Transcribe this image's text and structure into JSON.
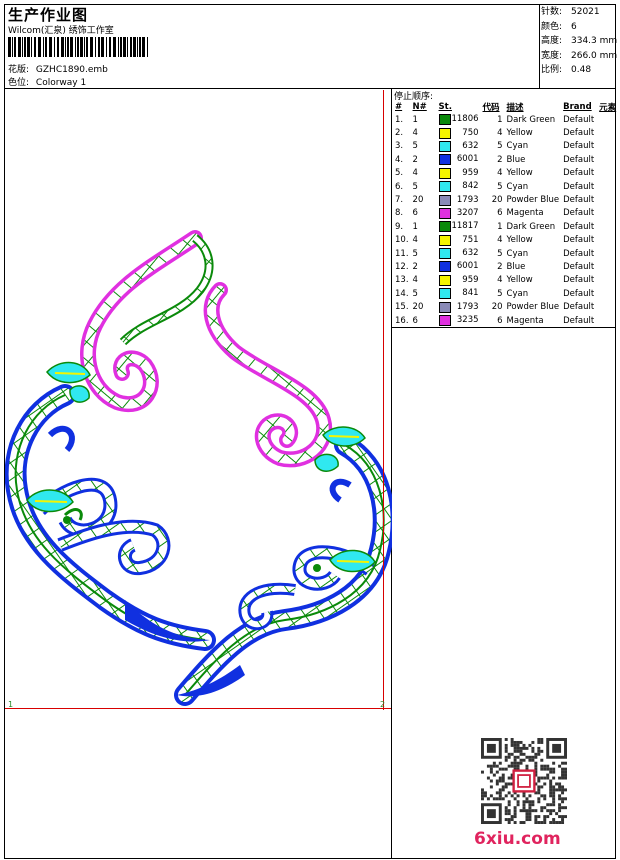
{
  "header": {
    "title": "生产作业图",
    "subtitle": "Wilcom(汇泉) 绣饰工作室",
    "design_label": "花版:",
    "design_value": "GZHC1890.emb",
    "colorway_label": "色位:",
    "colorway_value": "Colorway 1"
  },
  "stats": [
    {
      "label": "针数:",
      "value": "52021"
    },
    {
      "label": "颜色:",
      "value": "6"
    },
    {
      "label": "高度:",
      "value": "334.3 mm"
    },
    {
      "label": "宽度:",
      "value": "266.0 mm"
    },
    {
      "label": "比例:",
      "value": "0.48"
    }
  ],
  "sequence": {
    "title": "停止顺序:",
    "headers": [
      "#",
      "N#",
      "St.",
      "代码",
      "描述",
      "Brand",
      "元素"
    ],
    "rows": [
      {
        "idx": "1.",
        "n": "1",
        "color": "#0a8a0a",
        "st": "11806",
        "code": "1",
        "desc": "Dark Green",
        "brand": "Default"
      },
      {
        "idx": "2.",
        "n": "4",
        "color": "#f5f500",
        "st": "750",
        "code": "4",
        "desc": "Yellow",
        "brand": "Default"
      },
      {
        "idx": "3.",
        "n": "5",
        "color": "#30e8f0",
        "st": "632",
        "code": "5",
        "desc": "Cyan",
        "brand": "Default"
      },
      {
        "idx": "4.",
        "n": "2",
        "color": "#1030e0",
        "st": "6001",
        "code": "2",
        "desc": "Blue",
        "brand": "Default"
      },
      {
        "idx": "5.",
        "n": "4",
        "color": "#f5f500",
        "st": "959",
        "code": "4",
        "desc": "Yellow",
        "brand": "Default"
      },
      {
        "idx": "6.",
        "n": "5",
        "color": "#30e8f0",
        "st": "842",
        "code": "5",
        "desc": "Cyan",
        "brand": "Default"
      },
      {
        "idx": "7.",
        "n": "20",
        "color": "#8a8ab8",
        "st": "1793",
        "code": "20",
        "desc": "Powder Blue",
        "brand": "Default"
      },
      {
        "idx": "8.",
        "n": "6",
        "color": "#e030e0",
        "st": "3207",
        "code": "6",
        "desc": "Magenta",
        "brand": "Default"
      },
      {
        "idx": "9.",
        "n": "1",
        "color": "#0a8a0a",
        "st": "11817",
        "code": "1",
        "desc": "Dark Green",
        "brand": "Default"
      },
      {
        "idx": "10.",
        "n": "4",
        "color": "#f5f500",
        "st": "751",
        "code": "4",
        "desc": "Yellow",
        "brand": "Default"
      },
      {
        "idx": "11.",
        "n": "5",
        "color": "#30e8f0",
        "st": "632",
        "code": "5",
        "desc": "Cyan",
        "brand": "Default"
      },
      {
        "idx": "12.",
        "n": "2",
        "color": "#1030e0",
        "st": "6001",
        "code": "2",
        "desc": "Blue",
        "brand": "Default"
      },
      {
        "idx": "13.",
        "n": "4",
        "color": "#f5f500",
        "st": "959",
        "code": "4",
        "desc": "Yellow",
        "brand": "Default"
      },
      {
        "idx": "14.",
        "n": "5",
        "color": "#30e8f0",
        "st": "841",
        "code": "5",
        "desc": "Cyan",
        "brand": "Default"
      },
      {
        "idx": "15.",
        "n": "20",
        "color": "#8a8ab8",
        "st": "1793",
        "code": "20",
        "desc": "Powder Blue",
        "brand": "Default"
      },
      {
        "idx": "16.",
        "n": "6",
        "color": "#e030e0",
        "st": "3235",
        "code": "6",
        "desc": "Magenta",
        "brand": "Default"
      }
    ]
  },
  "markers": {
    "left": "1",
    "right": "2"
  },
  "logo": {
    "text": "6xiu.com"
  },
  "colors": {
    "frame_line": "#d80000",
    "dark_green": "#0a8a0a",
    "blue": "#1030e0",
    "magenta": "#e030e0",
    "cyan": "#30e8f0",
    "yellow": "#f5f500",
    "logo_pink": "#e0245e"
  }
}
